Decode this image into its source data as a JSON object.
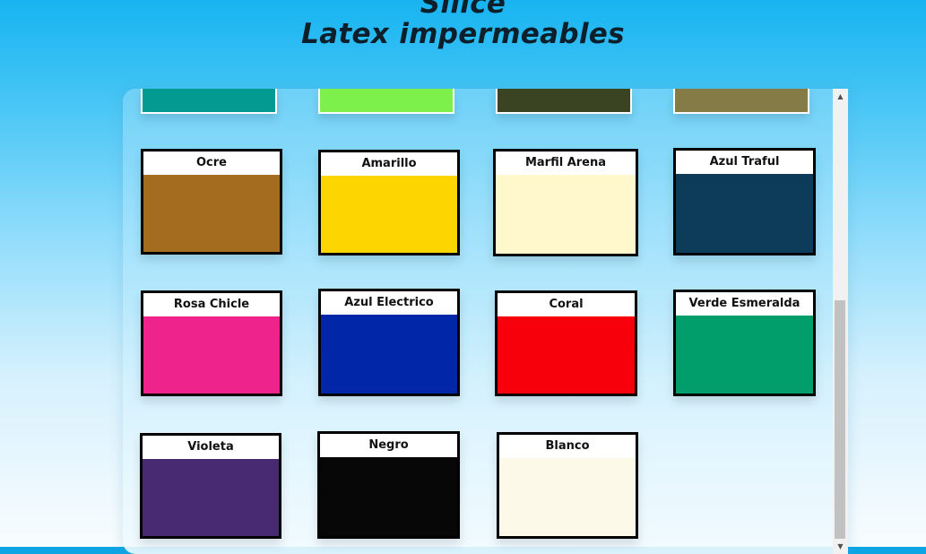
{
  "header": {
    "line1": "Silice",
    "line2": "Latex impermeables"
  },
  "scrollbar": {
    "up_icon": "▲",
    "down_icon": "▼"
  },
  "colors": {
    "top_row": [
      "#039b91",
      "#7df04c",
      "#3a4322",
      "#857b47"
    ],
    "cards": [
      {
        "label": "Ocre",
        "color": "#a46c1f"
      },
      {
        "label": "Amarillo",
        "color": "#fdd500"
      },
      {
        "label": "Marfil Arena",
        "color": "#fff8cc"
      },
      {
        "label": "Azul Traful",
        "color": "#0c3c5a"
      },
      {
        "label": "Rosa Chicle",
        "color": "#ee248c"
      },
      {
        "label": "Azul Electrico",
        "color": "#0126a8"
      },
      {
        "label": "Coral",
        "color": "#f7000b"
      },
      {
        "label": "Verde Esmeralda",
        "color": "#019e6c"
      },
      {
        "label": "Violeta",
        "color": "#482a72"
      },
      {
        "label": "Negro",
        "color": "#070707"
      },
      {
        "label": "Blanco",
        "color": "#fdf9e8"
      }
    ]
  }
}
